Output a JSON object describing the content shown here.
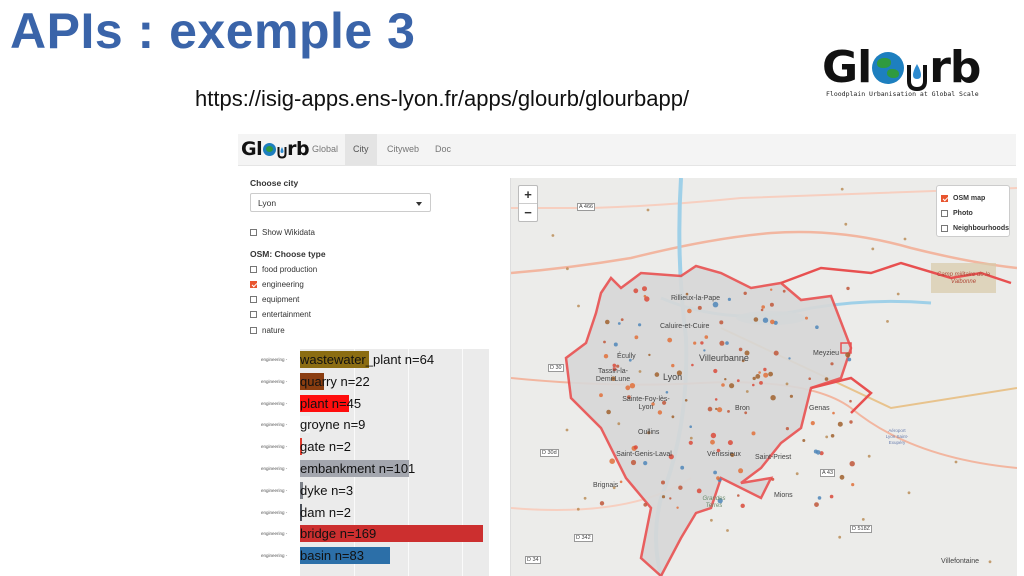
{
  "slide": {
    "title": "APIs : exemple 3",
    "url": "https://isig-apps.ens-lyon.fr/apps/glourb/glourbapp/"
  },
  "logo": {
    "text_left": "Gl",
    "text_right": "rb",
    "subtitle": "Floodplain Urbanisation at Global Scale"
  },
  "app": {
    "brand_left": "Gl",
    "brand_right": "rb",
    "tabs": [
      {
        "label": "Global",
        "active": false
      },
      {
        "label": "City",
        "active": true
      },
      {
        "label": "Cityweb",
        "active": false
      },
      {
        "label": "Doc",
        "active": false
      }
    ],
    "sidebar": {
      "choose_city_label": "Choose city",
      "city_value": "Lyon",
      "show_wikidata_label": "Show Wikidata",
      "osm_type_label": "OSM: Choose type",
      "types": [
        {
          "label": "food production",
          "checked": false
        },
        {
          "label": "engineering",
          "checked": true
        },
        {
          "label": "equipment",
          "checked": false
        },
        {
          "label": "entertainment",
          "checked": false
        },
        {
          "label": "nature",
          "checked": false
        }
      ]
    },
    "map": {
      "zoom_in": "+",
      "zoom_out": "−",
      "layers": [
        {
          "label": "OSM map",
          "checked": true
        },
        {
          "label": "Photo",
          "checked": false
        },
        {
          "label": "Neighbourhoods",
          "checked": false
        }
      ],
      "places": [
        "Rillieux-la-Pape",
        "Caluire-et-Cuire",
        "Villeurbanne",
        "Écully",
        "Lyon",
        "Meyzieu",
        "Tassin-la-Demi-Lune",
        "Sainte-Foy-lès-Lyon",
        "Bron",
        "Genas",
        "Oullins",
        "Saint-Genis-Laval",
        "Vénissieux",
        "Saint-Priest",
        "Brignais",
        "Mions",
        "Villefontaine",
        "Camp militaire de la Valbonne",
        "Grandes Terres",
        "Aéroport Lyon Saint-Exupéry"
      ],
      "roads": [
        "A 466",
        "D 30",
        "D 30d",
        "A 43",
        "D 518Z",
        "D 342",
        "D 34"
      ]
    }
  },
  "chart_data": {
    "type": "bar",
    "orientation": "horizontal",
    "facet_label": "engineering",
    "categories": [
      "wastewater_plant",
      "quarry",
      "plant",
      "groyne",
      "gate",
      "embankment",
      "dyke",
      "dam",
      "bridge",
      "basin"
    ],
    "values": [
      64,
      22,
      45,
      9,
      2,
      101,
      3,
      2,
      169,
      83
    ],
    "labels": [
      "wastewater_plant n=64",
      "quarry n=22",
      "plant n=45",
      "groyne n=9",
      "gate n=2",
      "embankment n=101",
      "dyke n=3",
      "dam n=2",
      "bridge n=169",
      "basin n=83"
    ],
    "colors": [
      "#8b6d12",
      "#8a3d10",
      "#ff0d0d",
      "#f2f2f2",
      "#e03a2c",
      "#a3a6ae",
      "#7d8189",
      "#4a4f58",
      "#cc2f2f",
      "#2c6fa8"
    ],
    "xlim": [
      0,
      175
    ],
    "grid": true
  }
}
